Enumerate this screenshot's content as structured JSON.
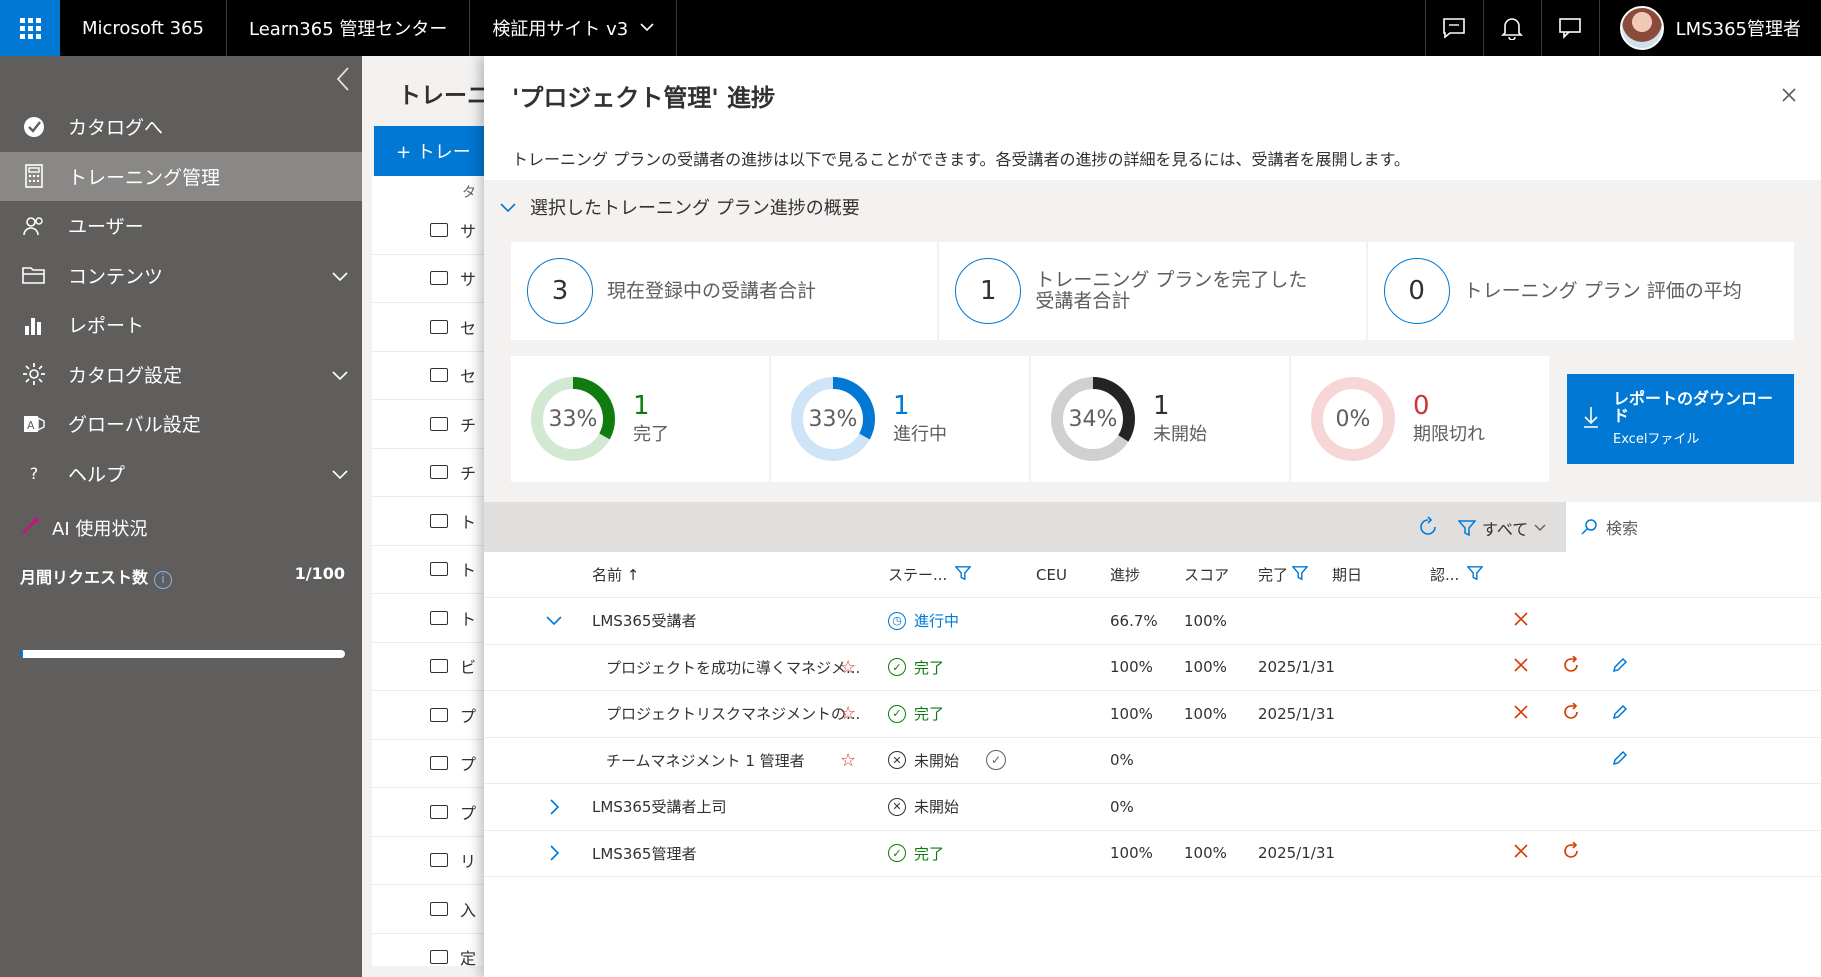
{
  "topbar": {
    "app_name": "Microsoft 365",
    "admin_center": "Learn365 管理センター",
    "site": "検証用サイト v3",
    "user_name": "LMS365管理者"
  },
  "sidebar": {
    "items": [
      {
        "label": "カタログへ",
        "icon": "check-circle-icon"
      },
      {
        "label": "トレーニング管理",
        "icon": "calculator-icon",
        "active": true
      },
      {
        "label": "ユーザー",
        "icon": "people-icon"
      },
      {
        "label": "コンテンツ",
        "icon": "folder-icon",
        "expandable": true
      },
      {
        "label": "レポート",
        "icon": "bar-chart-icon"
      },
      {
        "label": "カタログ設定",
        "icon": "gear-icon",
        "expandable": true
      },
      {
        "label": "グローバル設定",
        "icon": "admin-icon"
      },
      {
        "label": "ヘルプ",
        "icon": "question-icon",
        "expandable": true
      }
    ],
    "ai_usage": "AI 使用状況",
    "monthly_requests_label": "月間リクエスト数",
    "monthly_requests_value": "1/100",
    "monthly_requests_fraction": 0.01
  },
  "background": {
    "title": "トレーニン",
    "new_button": "+ トレー",
    "column_head": "タ",
    "rows": [
      "サ",
      "サ",
      "セ",
      "セ",
      "チ",
      "チ",
      "ト",
      "ト",
      "ト",
      "ビ",
      "プ",
      "プ",
      "プ",
      "リ",
      "入",
      "定"
    ]
  },
  "panel": {
    "title": "'プロジェクト管理' 進捗",
    "description": "トレーニング プランの受講者の進捗は以下で見ることができます。各受講者の進捗の詳細を見るには、受講者を展開します。",
    "summary_header": "選択したトレーニング プラン進捗の概要",
    "stats": [
      {
        "value": "3",
        "label": "現在登録中の受講者合計"
      },
      {
        "value": "1",
        "label": "トレーニング プランを完了した受講者合計"
      },
      {
        "value": "0",
        "label": "トレーニング プラン 評価の平均"
      }
    ],
    "donuts": [
      {
        "pct_label": "33%",
        "count": "1",
        "label": "完了",
        "fraction": 0.33,
        "color": "#107c10",
        "track": "#d3e8d3",
        "num_color": "#107c10"
      },
      {
        "pct_label": "33%",
        "count": "1",
        "label": "進行中",
        "fraction": 0.33,
        "color": "#0078d4",
        "track": "#cfe4f7",
        "num_color": "#0078d4"
      },
      {
        "pct_label": "34%",
        "count": "1",
        "label": "未開始",
        "fraction": 0.34,
        "color": "#252423",
        "track": "#d2d0ce",
        "num_color": "#323130"
      },
      {
        "pct_label": "0%",
        "count": "0",
        "label": "期限切れ",
        "fraction": 0,
        "color": "#d13438",
        "track": "#f6d6d7",
        "num_color": "#d13438"
      }
    ],
    "download": {
      "title": "レポートのダウンロード",
      "subtitle": "Excelファイル"
    },
    "toolbar": {
      "filter_label": "すべて",
      "search_placeholder": "検索"
    },
    "columns": {
      "name": "名前 ↑",
      "status": "ステー...",
      "ceu": "CEU",
      "progress": "進捗",
      "score": "スコア",
      "complete": "完了",
      "date": "期日",
      "cert": "認..."
    },
    "rows": [
      {
        "level": 0,
        "expander": "﹀",
        "name": "LMS365受講者",
        "status": "進行中",
        "status_type": "prog",
        "progress": "66.7%",
        "score": "100%",
        "complete": "",
        "star": false,
        "actions": [
          "x"
        ]
      },
      {
        "level": 1,
        "expander": "",
        "name": "プロジェクトを成功に導くマネジメ...",
        "status": "完了",
        "status_type": "done",
        "progress": "100%",
        "score": "100%",
        "complete": "2025/1/31",
        "star": true,
        "actions": [
          "x",
          "redo",
          "edit"
        ]
      },
      {
        "level": 1,
        "expander": "",
        "name": "プロジェクトリスクマネジメントの...",
        "status": "完了",
        "status_type": "done",
        "progress": "100%",
        "score": "100%",
        "complete": "2025/1/31",
        "star": true,
        "actions": [
          "x",
          "redo",
          "edit"
        ]
      },
      {
        "level": 1,
        "expander": "",
        "name": "チームマネジメント 1 管理者",
        "status": "未開始",
        "status_type": "not",
        "progress": "0%",
        "score": "",
        "complete": "",
        "star": true,
        "check": true,
        "actions": [
          "edit"
        ]
      },
      {
        "level": 0,
        "expander": "›",
        "name": "LMS365受講者上司",
        "status": "未開始",
        "status_type": "not",
        "progress": "0%",
        "score": "",
        "complete": "",
        "star": false,
        "actions": []
      },
      {
        "level": 0,
        "expander": "›",
        "name": "LMS365管理者",
        "status": "完了",
        "status_type": "done",
        "progress": "100%",
        "score": "100%",
        "complete": "2025/1/31",
        "star": false,
        "actions": [
          "x",
          "redo"
        ]
      }
    ]
  }
}
